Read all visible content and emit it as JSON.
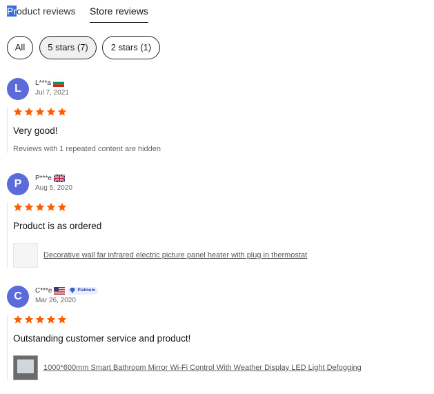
{
  "tabs": {
    "product_reviews_selected": "Pr",
    "product_reviews_rest": "oduct reviews",
    "store_reviews": "Store reviews"
  },
  "filters": [
    {
      "label": "All",
      "active": false
    },
    {
      "label": "5 stars (7)",
      "active": true
    },
    {
      "label": "2 stars (1)",
      "active": false
    }
  ],
  "reviews": [
    {
      "initial": "L",
      "name": "L***a",
      "flag": "bulgaria-flag",
      "date": "Jul 7, 2021",
      "stars": 5,
      "text": "Very good!",
      "note": "Reviews with 1 repeated content are hidden"
    },
    {
      "initial": "P",
      "name": "P***e",
      "flag": "uk-flag",
      "date": "Aug 5, 2020",
      "stars": 5,
      "text": "Product is as ordered",
      "product": "Decorative wall far infrared electric picture panel heater with plug in thermostat"
    },
    {
      "initial": "C",
      "name": "C***e",
      "flag": "usa-flag",
      "badge": "Platinum",
      "date": "Mar 26, 2020",
      "stars": 5,
      "text": "Outstanding customer service and product!",
      "product": "1000*600mm Smart Bathroom Mirror Wi-Fi Control With Weather Display LED Light Defogging"
    }
  ],
  "colors": {
    "star": "#ff5c00",
    "avatar": "#5b6bd9",
    "tab_highlight": "#3b6ddb"
  }
}
